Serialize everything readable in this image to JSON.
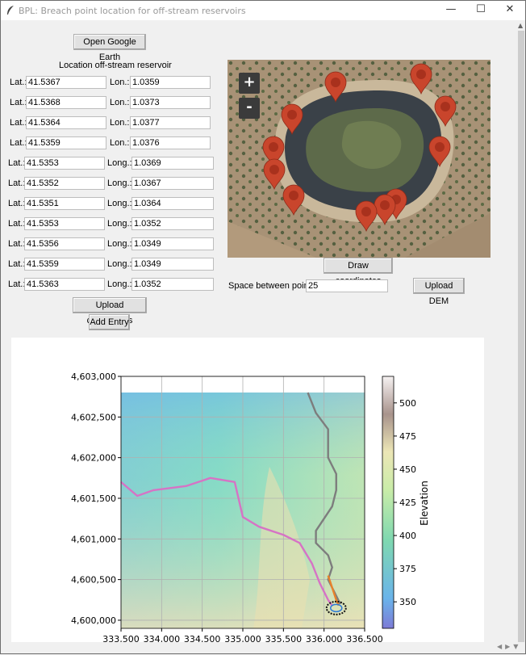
{
  "window": {
    "title": "BPL: Breach point location for off-stream reservoirs",
    "minimize": "—",
    "maximize": "☐",
    "close": "✕"
  },
  "buttons": {
    "open_google_earth": "Open Google Earth",
    "draw_coordinates": "Draw coordinates",
    "upload_dem": "Upload DEM",
    "upload_coordinates": "Upload coordinates",
    "add_entry": "Add Entry"
  },
  "heading": "Location off-stream reservoir",
  "lat_label": "Lat.:",
  "rows": [
    {
      "lat": "41.5367",
      "lon_label": "Lon.:",
      "lon": "1.0359"
    },
    {
      "lat": "41.5368",
      "lon_label": "Lon.:",
      "lon": "1.0373"
    },
    {
      "lat": "41.5364",
      "lon_label": "Lon.:",
      "lon": "1.0377"
    },
    {
      "lat": "41.5359",
      "lon_label": "Lon.:",
      "lon": "1.0376"
    },
    {
      "lat": "41.5353",
      "lon_label": "Long.:",
      "lon": "1.0369"
    },
    {
      "lat": "41.5352",
      "lon_label": "Long.:",
      "lon": "1.0367"
    },
    {
      "lat": "41.5351",
      "lon_label": "Long.:",
      "lon": "1.0364"
    },
    {
      "lat": "41.5353",
      "lon_label": "Long.:",
      "lon": "1.0352"
    },
    {
      "lat": "41.5356",
      "lon_label": "Long.:",
      "lon": "1.0349"
    },
    {
      "lat": "41.5359",
      "lon_label": "Long.:",
      "lon": "1.0349"
    },
    {
      "lat": "41.5363",
      "lon_label": "Long.:",
      "lon": "1.0352"
    }
  ],
  "spacing": {
    "label": "Space between points",
    "value": "25"
  },
  "map": {
    "zoom_in": "+",
    "zoom_out": "-",
    "marker_count": 11
  },
  "colors": {
    "marker": "#c9452c",
    "pink_path": "#d673c5",
    "gray_path": "#7d7d7d",
    "orange_path": "#e8822a"
  },
  "chart_data": {
    "type": "heatmap",
    "title": "",
    "xlabel": "",
    "ylabel": "",
    "xlim": [
      333500,
      336500
    ],
    "ylim": [
      4599900,
      4603000
    ],
    "x_ticks": [
      "333,500",
      "334,000",
      "334,500",
      "335,000",
      "335,500",
      "336,000",
      "336,500"
    ],
    "y_ticks": [
      "4,603,000",
      "4,602,500",
      "4,602,000",
      "4,601,500",
      "4,601,000",
      "4,600,500",
      "4,600,000"
    ],
    "grid": true,
    "colorbar": {
      "label": "Elevation",
      "range": [
        330,
        520
      ],
      "ticks": [
        "500",
        "475",
        "450",
        "425",
        "400",
        "375",
        "350"
      ]
    },
    "series": [
      {
        "color": "#d673c5",
        "x": [
          333500,
          333700,
          333900,
          334300,
          334600,
          334900,
          335000,
          335200,
          335500,
          335700,
          335850,
          335950,
          336050,
          336100
        ],
        "y": [
          4601700,
          4601530,
          4601600,
          4601650,
          4601750,
          4601700,
          4601270,
          4601150,
          4601050,
          4600950,
          4600700,
          4600450,
          4600250,
          4600180
        ]
      },
      {
        "color": "#7d7d7d",
        "x": [
          335800,
          335900,
          336050,
          336050,
          336150,
          336150,
          336100,
          335900,
          335900,
          336050,
          336100,
          336050,
          336150,
          336200
        ],
        "y": [
          4602800,
          4602550,
          4602350,
          4602000,
          4601800,
          4601600,
          4601400,
          4601100,
          4600950,
          4600800,
          4600650,
          4600500,
          4600300,
          4600200
        ]
      },
      {
        "color": "#e8822a",
        "x": [
          336050,
          336100,
          336150,
          336180
        ],
        "y": [
          4600550,
          4600400,
          4600250,
          4600180
        ]
      }
    ]
  }
}
